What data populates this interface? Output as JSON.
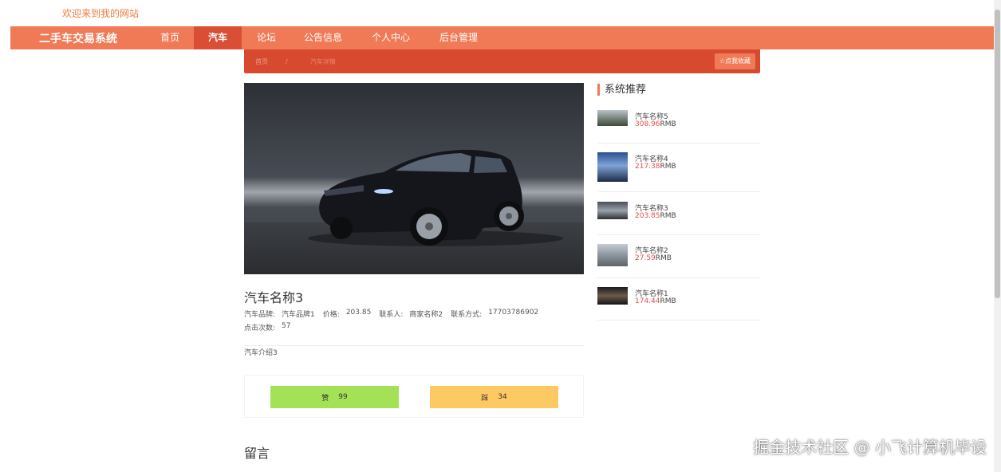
{
  "header": {
    "welcome": "欢迎来到我的网站"
  },
  "navbar": {
    "brand": "二手车交易系统",
    "items": [
      {
        "label": "首页",
        "active": false
      },
      {
        "label": "汽车",
        "active": true
      },
      {
        "label": "论坛",
        "active": false
      },
      {
        "label": "公告信息",
        "active": false
      },
      {
        "label": "个人中心",
        "active": false
      },
      {
        "label": "后台管理",
        "active": false
      }
    ]
  },
  "breadcrumb": {
    "home": "首页",
    "separator": "/",
    "current": "汽车详情",
    "favorite_label": "☆点我收藏"
  },
  "detail": {
    "title": "汽车名称3",
    "brand_label": "汽车品牌:",
    "brand_value": "汽车品牌1",
    "price_label": "价格:",
    "price_value": "203.85",
    "contact_label": "联系人:",
    "contact_value": "商家名称2",
    "phone_label": "联系方式:",
    "phone_value": "17703786902",
    "clicks_label": "点击次数:",
    "clicks_value": "57",
    "intro": "汽车介绍3"
  },
  "votes": {
    "like_label": "赞",
    "like_count": "99",
    "dislike_label": "踩",
    "dislike_count": "34"
  },
  "comments": {
    "title": "留言"
  },
  "sidebar": {
    "title": "系统推荐",
    "currency": "RMB",
    "items": [
      {
        "name": "汽车名称5",
        "price": "308.96"
      },
      {
        "name": "汽车名称4",
        "price": "217.38"
      },
      {
        "name": "汽车名称3",
        "price": "203.85"
      },
      {
        "name": "汽车名称2",
        "price": "27.59"
      },
      {
        "name": "汽车名称1",
        "price": "174.44"
      }
    ]
  },
  "watermark": "掘金技术社区 @ 小飞计算机毕设",
  "colors": {
    "nav": "#f07a56",
    "nav_active": "#d94e34",
    "like": "#a3e256",
    "dislike": "#fdc962",
    "price": "#e84d4d"
  }
}
